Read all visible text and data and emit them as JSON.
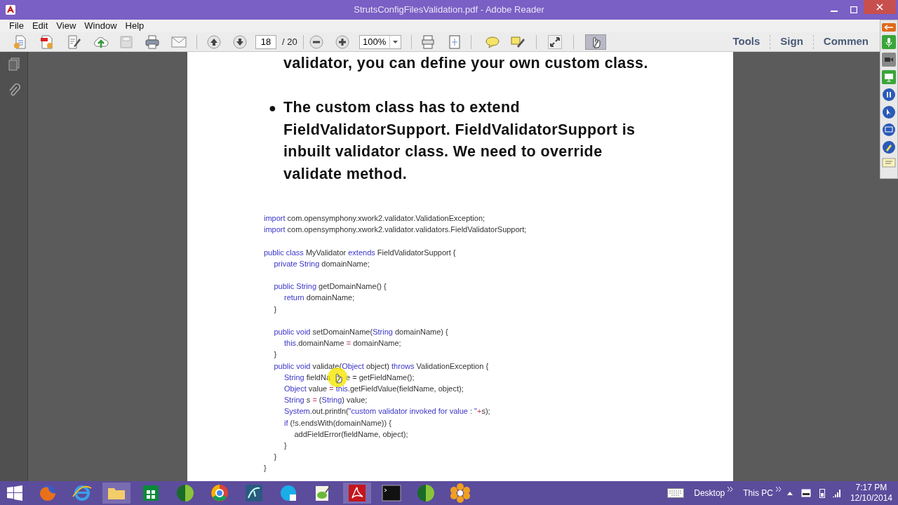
{
  "window": {
    "title": "StrutsConfigFilesValidation.pdf - Adobe Reader"
  },
  "menu": [
    "File",
    "Edit",
    "View",
    "Window",
    "Help"
  ],
  "toolbar": {
    "page": "18",
    "page_total": "/ 20",
    "zoom": "100%",
    "hand_tool_selected": true,
    "panels": [
      {
        "label": "Tools"
      },
      {
        "label": "Sign"
      },
      {
        "label": "Commen"
      }
    ]
  },
  "document": {
    "top_line": "validator, you can define your own custom class.",
    "bullet": {
      "marker": "●",
      "text": "The custom class has to extend FieldValidatorSupport. FieldValidatorSupport is inbuilt validator class. We need to override validate method."
    },
    "code": [
      {
        "kind": "line",
        "tokens": [
          {
            "kind": "kw",
            "text": "import"
          },
          {
            "kind": "plain",
            "text": " com.opensymphony.xwork2.validator.ValidationException;"
          }
        ]
      },
      {
        "kind": "line",
        "tokens": [
          {
            "kind": "kw",
            "text": "import"
          },
          {
            "kind": "plain",
            "text": " com.opensymphony.xwork2.validator.validators.FieldValidatorSupport;"
          }
        ]
      },
      {
        "kind": "blank"
      },
      {
        "kind": "line",
        "tokens": [
          {
            "kind": "kw",
            "text": "public class"
          },
          {
            "kind": "plain",
            "text": " MyValidator "
          },
          {
            "kind": "kw",
            "text": "extends"
          },
          {
            "kind": "plain",
            "text": " FieldValidatorSupport {"
          }
        ],
        "children": [
          {
            "kind": "line",
            "tokens": [
              {
                "kind": "kw",
                "text": "private String"
              },
              {
                "kind": "plain",
                "text": " domainName;"
              }
            ]
          },
          {
            "kind": "blank"
          },
          {
            "kind": "line",
            "tokens": [
              {
                "kind": "kw",
                "text": "public String"
              },
              {
                "kind": "plain",
                "text": " getDomainName() {"
              }
            ],
            "children": [
              {
                "kind": "line",
                "tokens": [
                  {
                    "kind": "kw",
                    "text": "return"
                  },
                  {
                    "kind": "plain",
                    "text": " domainName;"
                  }
                ]
              }
            ]
          },
          {
            "kind": "line",
            "tokens": [
              {
                "kind": "plain",
                "text": "}"
              }
            ]
          },
          {
            "kind": "blank"
          },
          {
            "kind": "line",
            "tokens": [
              {
                "kind": "kw",
                "text": "public void"
              },
              {
                "kind": "plain",
                "text": " setDomainName("
              },
              {
                "kind": "kw",
                "text": "String"
              },
              {
                "kind": "plain",
                "text": " domainName) {"
              }
            ],
            "children": [
              {
                "kind": "line",
                "tokens": [
                  {
                    "kind": "kw",
                    "text": "this"
                  },
                  {
                    "kind": "plain",
                    "text": ".domainName "
                  },
                  {
                    "kind": "op",
                    "text": "="
                  },
                  {
                    "kind": "plain",
                    "text": " domainName;"
                  }
                ]
              }
            ]
          },
          {
            "kind": "line",
            "tokens": [
              {
                "kind": "plain",
                "text": "}"
              }
            ]
          },
          {
            "kind": "line",
            "tokens": [
              {
                "kind": "kw",
                "text": "public void"
              },
              {
                "kind": "plain",
                "text": " validate("
              },
              {
                "kind": "kw",
                "text": "Object"
              },
              {
                "kind": "plain",
                "text": " object) "
              },
              {
                "kind": "kw",
                "text": "throws"
              },
              {
                "kind": "plain",
                "text": " ValidationException {"
              }
            ],
            "children": [
              {
                "kind": "line",
                "tokens": [
                  {
                    "kind": "kw",
                    "text": "String"
                  },
                  {
                    "kind": "plain",
                    "text": " fieldNa"
                  }
                ]
              },
              {
                "kind": "line",
                "tokens": [
                  {
                    "kind": "kw",
                    "text": "Object"
                  },
                  {
                    "kind": "plain",
                    "text": " value "
                  },
                  {
                    "kind": "op",
                    "text": "="
                  },
                  {
                    "kind": "kw",
                    "text": " this"
                  },
                  {
                    "kind": "plain",
                    "text": ".getFieldValue(fieldName, object);"
                  }
                ]
              },
              {
                "kind": "line",
                "tokens": [
                  {
                    "kind": "kw",
                    "text": "String"
                  },
                  {
                    "kind": "plain",
                    "text": " s "
                  },
                  {
                    "kind": "op",
                    "text": "="
                  },
                  {
                    "kind": "plain",
                    "text": " ("
                  },
                  {
                    "kind": "kw",
                    "text": "String"
                  },
                  {
                    "kind": "plain",
                    "text": ") value;"
                  }
                ]
              },
              {
                "kind": "line",
                "tokens": [
                  {
                    "kind": "kw",
                    "text": "System"
                  },
                  {
                    "kind": "plain",
                    "text": ".out.println("
                  },
                  {
                    "kind": "kw",
                    "text": "\"custom validator invoked for value : \""
                  },
                  {
                    "kind": "op",
                    "text": "+"
                  },
                  {
                    "kind": "plain",
                    "text": "s);"
                  }
                ]
              },
              {
                "kind": "line",
                "tokens": [
                  {
                    "kind": "kw",
                    "text": "if"
                  },
                  {
                    "kind": "plain",
                    "text": " (!s.endsWith(domainName)) {"
                  }
                ],
                "children": [
                  {
                    "kind": "line",
                    "tokens": [
                      {
                        "kind": "plain",
                        "text": "addFieldError(fieldName, object);"
                      }
                    ]
                  }
                ]
              },
              {
                "kind": "line",
                "tokens": [
                  {
                    "kind": "plain",
                    "text": "}"
                  }
                ]
              }
            ]
          },
          {
            "kind": "line",
            "tokens": [
              {
                "kind": "plain",
                "text": "}"
              }
            ]
          }
        ]
      },
      {
        "kind": "line",
        "tokens": [
          {
            "kind": "plain",
            "text": "}"
          }
        ]
      }
    ],
    "cursor_overlay": {
      "after_text": "e = getFieldName();"
    }
  },
  "taskbar": {
    "tray": [
      {
        "label": "Desktop"
      },
      {
        "label": "This PC"
      }
    ],
    "time": "7:17 PM",
    "date": "12/10/2014"
  }
}
